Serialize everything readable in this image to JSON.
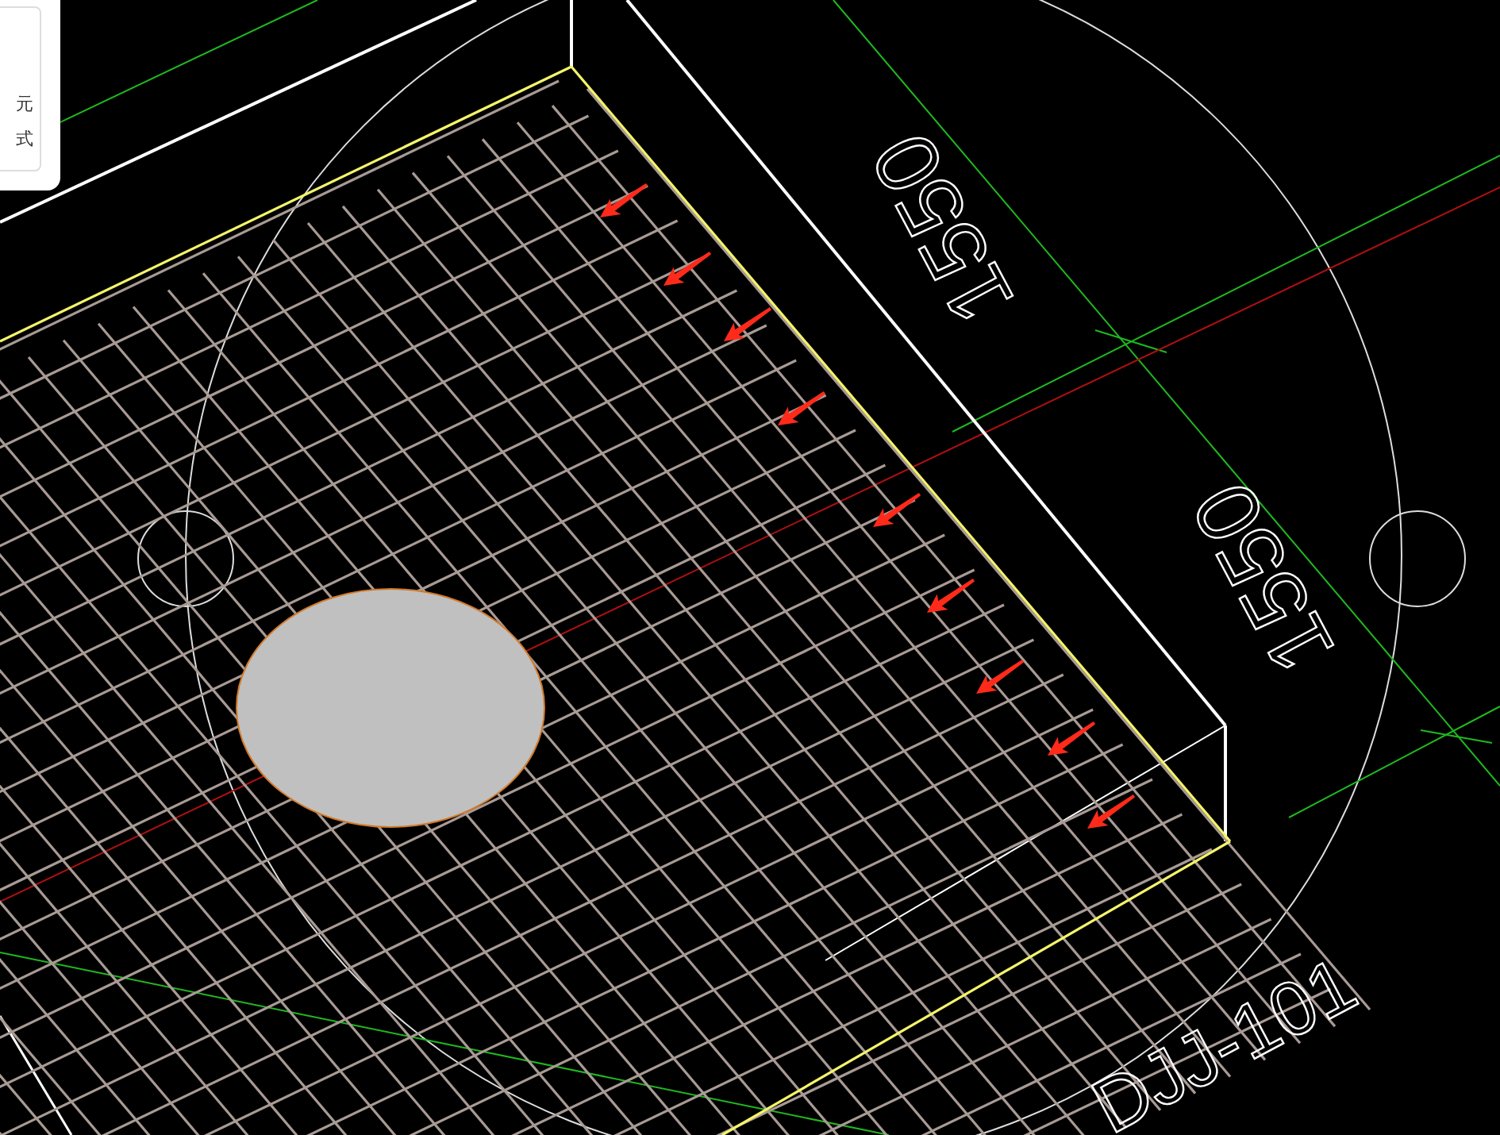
{
  "panel": {
    "items": [
      "元",
      "式"
    ]
  },
  "viewport": {
    "dimension_labels": [
      "1550",
      "1550"
    ],
    "foundation_label": "DJJ-101"
  }
}
